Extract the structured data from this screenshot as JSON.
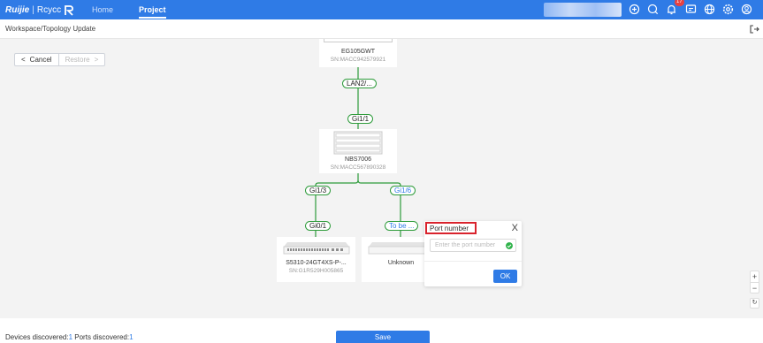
{
  "header": {
    "brand": "Ruijie",
    "product": "Rcycc",
    "nav": {
      "home": "Home",
      "project": "Project"
    },
    "notification_count": "17",
    "accent_color": "#2f7be6"
  },
  "subheader": {
    "breadcrumb": "Workspace/Topology Update"
  },
  "toolbar": {
    "cancel": "Cancel",
    "restore": "Restore"
  },
  "devices": {
    "gateway": {
      "name": "EG105GWT",
      "sn": "SN:MACC942579921"
    },
    "core": {
      "name": "NBS7006",
      "sn": "SN:MACC567890328"
    },
    "access": {
      "name": "S5310-24GT4XS-P-...",
      "sn": "SN:G1R529H005865"
    },
    "unknown": {
      "name": "Unknown"
    }
  },
  "ports": {
    "gateway_down": "LAN2/...",
    "core_up": "Gi1/1",
    "core_left": "Gi1/3",
    "core_right": "Gi1/6",
    "access_up": "Gi0/1",
    "unknown_up": "To be ..."
  },
  "popup": {
    "title": "Port number",
    "close": "X",
    "placeholder": "Enter the port number",
    "ok": "OK"
  },
  "zoom": {
    "in": "+",
    "out": "−"
  },
  "footer": {
    "devices_label": "Devices discovered:",
    "devices_count": "1",
    "ports_label": " Ports discovered:",
    "ports_count": "1",
    "save": "Save"
  }
}
